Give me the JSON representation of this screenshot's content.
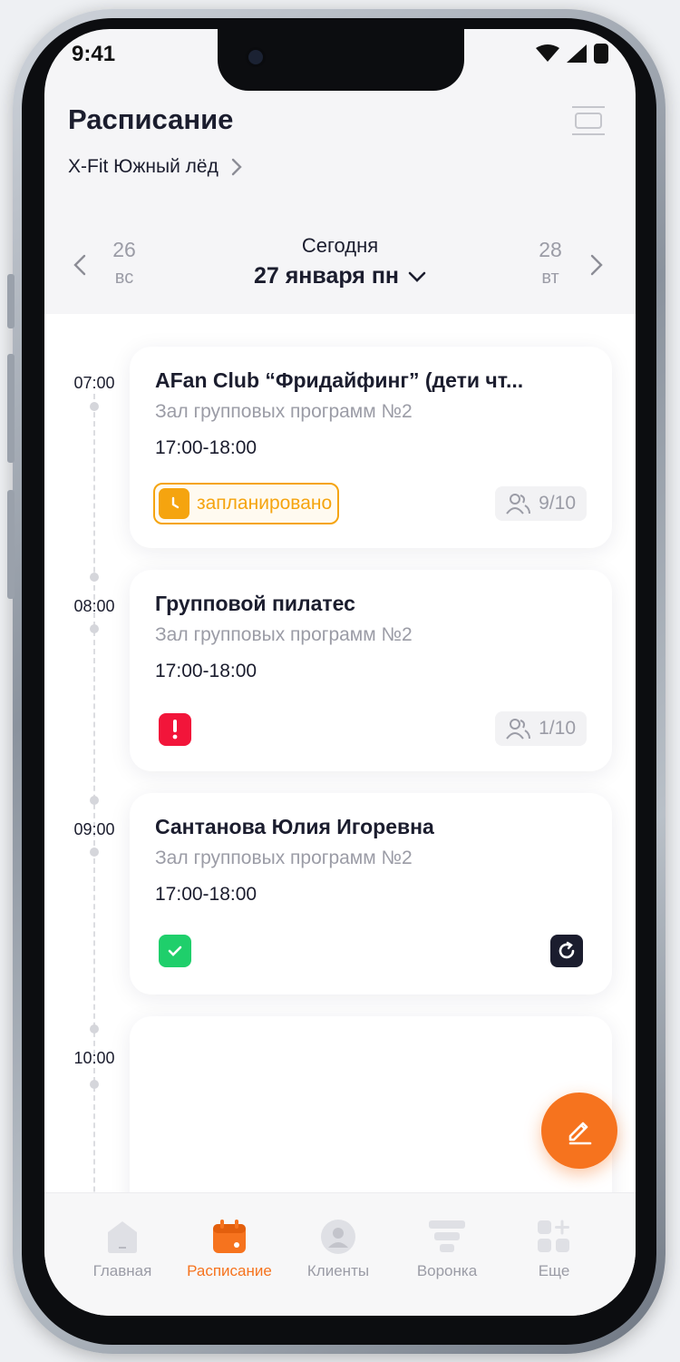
{
  "status_bar": {
    "time": "9:41"
  },
  "header": {
    "title": "Расписание",
    "club": "X-Fit Южный лёд"
  },
  "date_nav": {
    "prev": {
      "day": "26",
      "weekday": "вс"
    },
    "today_label": "Сегодня",
    "current": "27 января пн",
    "next": {
      "day": "28",
      "weekday": "вт"
    }
  },
  "timeline": [
    "07:00",
    "08:00",
    "09:00",
    "10:00"
  ],
  "events": [
    {
      "title": "AFan Club “Фридайфинг” (дети чт...",
      "room": "Зал групповых программ №2",
      "time": "17:00-18:00",
      "status": "запланировано",
      "seats": "9/10"
    },
    {
      "title": "Групповой пилатес",
      "room": "Зал групповых программ №2",
      "time": "17:00-18:00",
      "status": "alert",
      "seats": "1/10"
    },
    {
      "title": "Сантанова Юлия Игоревна",
      "room": "Зал групповых программ №2",
      "time": "17:00-18:00",
      "status": "done"
    }
  ],
  "tabs": [
    {
      "label": "Главная",
      "icon": "home-icon"
    },
    {
      "label": "Расписание",
      "icon": "calendar-icon",
      "active": true
    },
    {
      "label": "Клиенты",
      "icon": "user-icon"
    },
    {
      "label": "Воронка",
      "icon": "funnel-icon"
    },
    {
      "label": "Еще",
      "icon": "more-grid-icon"
    }
  ],
  "colors": {
    "accent": "#f6731e",
    "planned": "#f5a40f",
    "alert": "#f2153a",
    "done": "#1fcf6b",
    "text": "#1b1d2e",
    "muted": "#9b9ca6"
  }
}
